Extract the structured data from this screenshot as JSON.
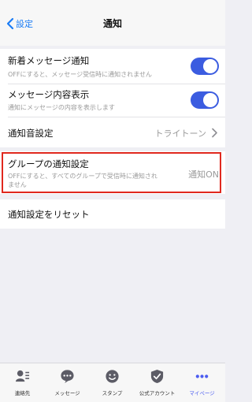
{
  "nav": {
    "back_label": "設定",
    "title": "通知"
  },
  "settings": {
    "new_message": {
      "title": "新着メッセージ通知",
      "description": "OFFにすると、メッセージ受信時に通知されません",
      "enabled": true
    },
    "show_content": {
      "title": "メッセージ内容表示",
      "description": "通知にメッセージの内容を表示します",
      "enabled": true
    },
    "sound": {
      "title": "通知音設定",
      "value": "トライトーン"
    },
    "group": {
      "title": "グループの通知設定",
      "description_line1": "OFFにすると、すべてのグループで受信時に通知され",
      "description_line2": "ません",
      "value": "通知ON"
    },
    "reset": {
      "title": "通知設定をリセット"
    }
  },
  "tabs": [
    {
      "label": "連絡先",
      "icon": "contacts-icon",
      "active": false
    },
    {
      "label": "メッセージ",
      "icon": "message-icon",
      "active": false
    },
    {
      "label": "スタンプ",
      "icon": "sticker-icon",
      "active": false
    },
    {
      "label": "公式アカウント",
      "icon": "official-account-icon",
      "active": false
    },
    {
      "label": "マイページ",
      "icon": "more-icon",
      "active": true
    }
  ],
  "colors": {
    "accent": "#1a7cf5",
    "toggle_on": "#3b5ce0",
    "highlight_border": "#e0281e",
    "active_tab": "#4b5cf0"
  }
}
